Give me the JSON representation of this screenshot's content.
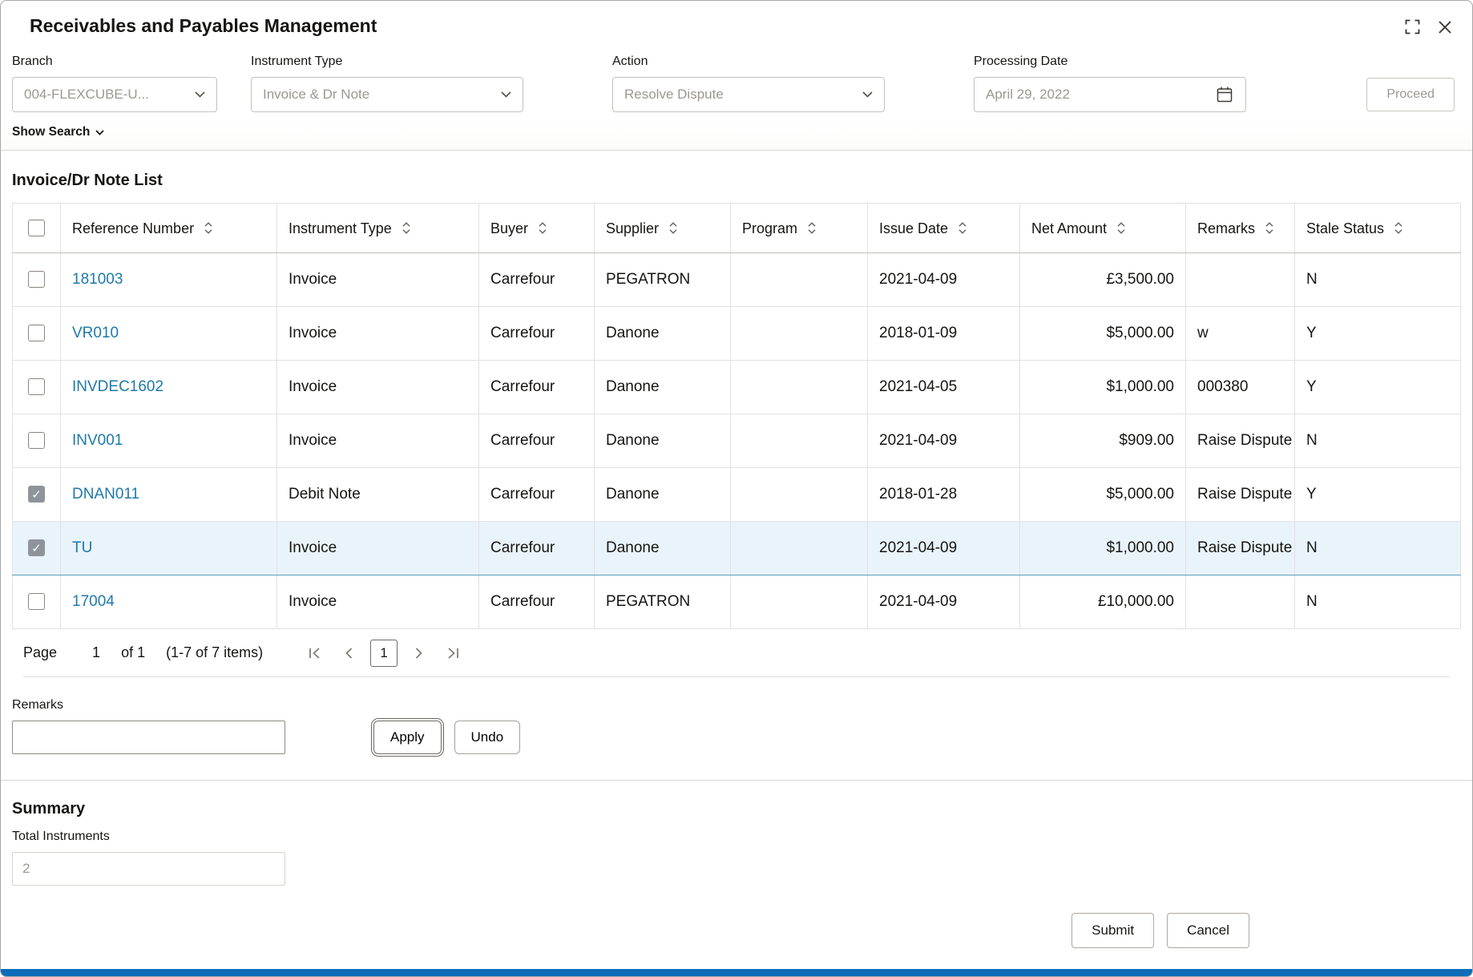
{
  "colors": {
    "link": "#2079a8",
    "selected_row_bg": "#e9f3fa",
    "selected_row_border": "#5b9bc0",
    "bottom_bar": "#0d6db8"
  },
  "window": {
    "title": "Receivables and Payables Management"
  },
  "filters": {
    "branch": {
      "label": "Branch",
      "value": "004-FLEXCUBE-U..."
    },
    "instrument_type": {
      "label": "Instrument Type",
      "value": "Invoice & Dr Note"
    },
    "action": {
      "label": "Action",
      "value": "Resolve Dispute"
    },
    "processing_date": {
      "label": "Processing Date",
      "value": "April 29, 2022"
    },
    "proceed_label": "Proceed"
  },
  "show_search_label": "Show Search",
  "list": {
    "title": "Invoice/Dr Note List",
    "columns": [
      "Reference Number",
      "Instrument Type",
      "Buyer",
      "Supplier",
      "Program",
      "Issue Date",
      "Net Amount",
      "Remarks",
      "Stale Status"
    ],
    "rows": [
      {
        "checked": false,
        "selected": false,
        "reference": "181003",
        "instrument_type": "Invoice",
        "buyer": "Carrefour",
        "supplier": "PEGATRON",
        "program": "",
        "issue_date": "2021-04-09",
        "net_amount": "£3,500.00",
        "remarks": "",
        "stale_status": "N"
      },
      {
        "checked": false,
        "selected": false,
        "reference": "VR010",
        "instrument_type": "Invoice",
        "buyer": "Carrefour",
        "supplier": "Danone",
        "program": "",
        "issue_date": "2018-01-09",
        "net_amount": "$5,000.00",
        "remarks": "w",
        "stale_status": "Y"
      },
      {
        "checked": false,
        "selected": false,
        "reference": "INVDEC1602",
        "instrument_type": "Invoice",
        "buyer": "Carrefour",
        "supplier": "Danone",
        "program": "",
        "issue_date": "2021-04-05",
        "net_amount": "$1,000.00",
        "remarks": "000380",
        "stale_status": "Y"
      },
      {
        "checked": false,
        "selected": false,
        "reference": "INV001",
        "instrument_type": "Invoice",
        "buyer": "Carrefour",
        "supplier": "Danone",
        "program": "",
        "issue_date": "2021-04-09",
        "net_amount": "$909.00",
        "remarks": "Raise Dispute",
        "stale_status": "N"
      },
      {
        "checked": true,
        "selected": false,
        "reference": "DNAN011",
        "instrument_type": "Debit Note",
        "buyer": "Carrefour",
        "supplier": "Danone",
        "program": "",
        "issue_date": "2018-01-28",
        "net_amount": "$5,000.00",
        "remarks": "Raise Dispute",
        "stale_status": "Y"
      },
      {
        "checked": true,
        "selected": true,
        "reference": "TU",
        "instrument_type": "Invoice",
        "buyer": "Carrefour",
        "supplier": "Danone",
        "program": "",
        "issue_date": "2021-04-09",
        "net_amount": "$1,000.00",
        "remarks": "Raise Dispute",
        "stale_status": "N"
      },
      {
        "checked": false,
        "selected": false,
        "reference": "17004",
        "instrument_type": "Invoice",
        "buyer": "Carrefour",
        "supplier": "PEGATRON",
        "program": "",
        "issue_date": "2021-04-09",
        "net_amount": "£10,000.00",
        "remarks": "",
        "stale_status": "N"
      }
    ]
  },
  "pagination": {
    "page_label": "Page",
    "page_value": "1",
    "of_label": "of 1",
    "items_label": "(1-7 of 7 items)",
    "current_page": "1"
  },
  "remarks": {
    "label": "Remarks",
    "value": "",
    "apply_label": "Apply",
    "undo_label": "Undo"
  },
  "summary": {
    "title": "Summary",
    "total_label": "Total Instruments",
    "total_value": "2"
  },
  "footer": {
    "submit_label": "Submit",
    "cancel_label": "Cancel"
  }
}
